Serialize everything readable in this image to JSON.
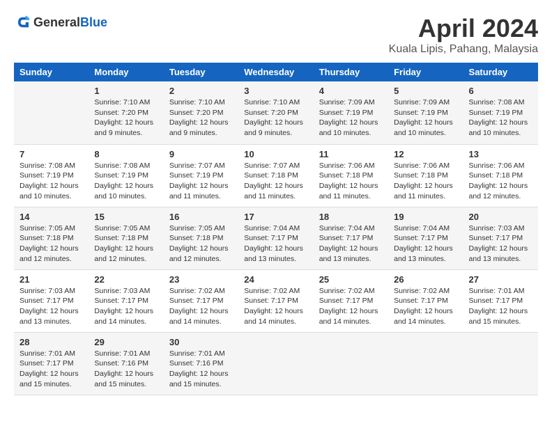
{
  "header": {
    "logo_general": "General",
    "logo_blue": "Blue",
    "title": "April 2024",
    "subtitle": "Kuala Lipis, Pahang, Malaysia"
  },
  "calendar": {
    "days_of_week": [
      "Sunday",
      "Monday",
      "Tuesday",
      "Wednesday",
      "Thursday",
      "Friday",
      "Saturday"
    ],
    "weeks": [
      {
        "days": [
          {
            "date": "",
            "info": ""
          },
          {
            "date": "1",
            "info": "Sunrise: 7:10 AM\nSunset: 7:20 PM\nDaylight: 12 hours\nand 9 minutes."
          },
          {
            "date": "2",
            "info": "Sunrise: 7:10 AM\nSunset: 7:20 PM\nDaylight: 12 hours\nand 9 minutes."
          },
          {
            "date": "3",
            "info": "Sunrise: 7:10 AM\nSunset: 7:20 PM\nDaylight: 12 hours\nand 9 minutes."
          },
          {
            "date": "4",
            "info": "Sunrise: 7:09 AM\nSunset: 7:19 PM\nDaylight: 12 hours\nand 10 minutes."
          },
          {
            "date": "5",
            "info": "Sunrise: 7:09 AM\nSunset: 7:19 PM\nDaylight: 12 hours\nand 10 minutes."
          },
          {
            "date": "6",
            "info": "Sunrise: 7:08 AM\nSunset: 7:19 PM\nDaylight: 12 hours\nand 10 minutes."
          }
        ]
      },
      {
        "days": [
          {
            "date": "7",
            "info": "Sunrise: 7:08 AM\nSunset: 7:19 PM\nDaylight: 12 hours\nand 10 minutes."
          },
          {
            "date": "8",
            "info": "Sunrise: 7:08 AM\nSunset: 7:19 PM\nDaylight: 12 hours\nand 10 minutes."
          },
          {
            "date": "9",
            "info": "Sunrise: 7:07 AM\nSunset: 7:19 PM\nDaylight: 12 hours\nand 11 minutes."
          },
          {
            "date": "10",
            "info": "Sunrise: 7:07 AM\nSunset: 7:18 PM\nDaylight: 12 hours\nand 11 minutes."
          },
          {
            "date": "11",
            "info": "Sunrise: 7:06 AM\nSunset: 7:18 PM\nDaylight: 12 hours\nand 11 minutes."
          },
          {
            "date": "12",
            "info": "Sunrise: 7:06 AM\nSunset: 7:18 PM\nDaylight: 12 hours\nand 11 minutes."
          },
          {
            "date": "13",
            "info": "Sunrise: 7:06 AM\nSunset: 7:18 PM\nDaylight: 12 hours\nand 12 minutes."
          }
        ]
      },
      {
        "days": [
          {
            "date": "14",
            "info": "Sunrise: 7:05 AM\nSunset: 7:18 PM\nDaylight: 12 hours\nand 12 minutes."
          },
          {
            "date": "15",
            "info": "Sunrise: 7:05 AM\nSunset: 7:18 PM\nDaylight: 12 hours\nand 12 minutes."
          },
          {
            "date": "16",
            "info": "Sunrise: 7:05 AM\nSunset: 7:18 PM\nDaylight: 12 hours\nand 12 minutes."
          },
          {
            "date": "17",
            "info": "Sunrise: 7:04 AM\nSunset: 7:17 PM\nDaylight: 12 hours\nand 13 minutes."
          },
          {
            "date": "18",
            "info": "Sunrise: 7:04 AM\nSunset: 7:17 PM\nDaylight: 12 hours\nand 13 minutes."
          },
          {
            "date": "19",
            "info": "Sunrise: 7:04 AM\nSunset: 7:17 PM\nDaylight: 12 hours\nand 13 minutes."
          },
          {
            "date": "20",
            "info": "Sunrise: 7:03 AM\nSunset: 7:17 PM\nDaylight: 12 hours\nand 13 minutes."
          }
        ]
      },
      {
        "days": [
          {
            "date": "21",
            "info": "Sunrise: 7:03 AM\nSunset: 7:17 PM\nDaylight: 12 hours\nand 13 minutes."
          },
          {
            "date": "22",
            "info": "Sunrise: 7:03 AM\nSunset: 7:17 PM\nDaylight: 12 hours\nand 14 minutes."
          },
          {
            "date": "23",
            "info": "Sunrise: 7:02 AM\nSunset: 7:17 PM\nDaylight: 12 hours\nand 14 minutes."
          },
          {
            "date": "24",
            "info": "Sunrise: 7:02 AM\nSunset: 7:17 PM\nDaylight: 12 hours\nand 14 minutes."
          },
          {
            "date": "25",
            "info": "Sunrise: 7:02 AM\nSunset: 7:17 PM\nDaylight: 12 hours\nand 14 minutes."
          },
          {
            "date": "26",
            "info": "Sunrise: 7:02 AM\nSunset: 7:17 PM\nDaylight: 12 hours\nand 14 minutes."
          },
          {
            "date": "27",
            "info": "Sunrise: 7:01 AM\nSunset: 7:17 PM\nDaylight: 12 hours\nand 15 minutes."
          }
        ]
      },
      {
        "days": [
          {
            "date": "28",
            "info": "Sunrise: 7:01 AM\nSunset: 7:17 PM\nDaylight: 12 hours\nand 15 minutes."
          },
          {
            "date": "29",
            "info": "Sunrise: 7:01 AM\nSunset: 7:16 PM\nDaylight: 12 hours\nand 15 minutes."
          },
          {
            "date": "30",
            "info": "Sunrise: 7:01 AM\nSunset: 7:16 PM\nDaylight: 12 hours\nand 15 minutes."
          },
          {
            "date": "",
            "info": ""
          },
          {
            "date": "",
            "info": ""
          },
          {
            "date": "",
            "info": ""
          },
          {
            "date": "",
            "info": ""
          }
        ]
      }
    ]
  }
}
